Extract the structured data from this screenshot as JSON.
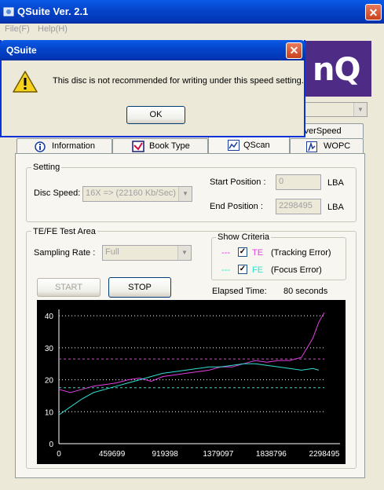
{
  "window": {
    "title": "QSuite Ver. 2.1",
    "close_glyph": "✕"
  },
  "menu": [
    {
      "label": "File(F)"
    },
    {
      "label": "Help(H)"
    }
  ],
  "logo": {
    "text": "nQ"
  },
  "tabs": {
    "back_row": [
      {
        "label": "OverSpeed"
      }
    ],
    "front_row": [
      {
        "label": "Information",
        "icon": "info-icon"
      },
      {
        "label": "Book Type",
        "icon": "book-type-icon"
      },
      {
        "label": "QScan",
        "icon": "qscan-icon",
        "selected": true
      },
      {
        "label": "WOPC",
        "icon": "wopc-icon"
      }
    ]
  },
  "setting": {
    "group_label": "Setting",
    "disc_speed_label": "Disc Speed:",
    "disc_speed_value": "16X => (22160 Kb/Sec)",
    "start_label": "Start Position :",
    "start_value": "0",
    "start_unit": "LBA",
    "end_label": "End Position :",
    "end_value": "2298495",
    "end_unit": "LBA"
  },
  "test_area": {
    "group_label": "TE/FE Test Area",
    "sampling_label": "Sampling Rate :",
    "sampling_value": "Full",
    "criteria_label": "Show Criteria",
    "te_line": "---",
    "te_code": "TE",
    "te_desc": "(Tracking Error)",
    "fe_line": "---",
    "fe_code": "FE",
    "fe_desc": "(Focus Error)",
    "check_glyph": "✓",
    "start_button": "START",
    "stop_button": "STOP",
    "elapsed_label": "Elapsed Time:",
    "elapsed_value": "80 seconds"
  },
  "colors": {
    "te": "#E040E0",
    "fe": "#30E0D0",
    "window_blue": "#0544C8",
    "logo_purple": "#4E2C86"
  },
  "chart_data": {
    "type": "line",
    "x_ticks": [
      0,
      459699,
      919398,
      1379097,
      1838796,
      2298495
    ],
    "y_ticks": [
      0,
      10,
      20,
      30,
      40
    ],
    "xlim": [
      0,
      2298495
    ],
    "ylim": [
      0,
      42
    ],
    "grid": "dotted horizontal at 10, 20, 30",
    "criteria": [
      {
        "name": "TE",
        "value": 26.5
      },
      {
        "name": "FE",
        "value": 17.5
      }
    ],
    "series": [
      {
        "name": "TE",
        "x": [
          0,
          100000,
          200000,
          300000,
          400000,
          500000,
          600000,
          700000,
          800000,
          900000,
          1000000,
          1100000,
          1200000,
          1300000,
          1400000,
          1500000,
          1600000,
          1700000,
          1800000,
          1900000,
          2000000,
          2100000,
          2200000,
          2250000,
          2298495
        ],
        "values": [
          17,
          16,
          17,
          18,
          18.5,
          19,
          20,
          20.5,
          19.5,
          21,
          21.5,
          22,
          22.5,
          23,
          24,
          24,
          25,
          26,
          25.5,
          26,
          26,
          27,
          33,
          38,
          41
        ]
      },
      {
        "name": "FE",
        "x": [
          0,
          100000,
          200000,
          300000,
          400000,
          500000,
          600000,
          700000,
          800000,
          900000,
          1000000,
          1100000,
          1200000,
          1300000,
          1400000,
          1500000,
          1600000,
          1700000,
          1800000,
          1900000,
          2000000,
          2100000,
          2200000,
          2250000
        ],
        "values": [
          9,
          11.5,
          14,
          16,
          17,
          18,
          19,
          20,
          21,
          22,
          22.5,
          23,
          23.5,
          24,
          24,
          24.5,
          25,
          25,
          24.5,
          24,
          23.5,
          23,
          23.5,
          23
        ]
      }
    ]
  },
  "dialog": {
    "title": "QSuite",
    "message": "This disc is not recommended for writing under this speed setting.",
    "ok_button": "OK",
    "close_glyph": "✕"
  }
}
